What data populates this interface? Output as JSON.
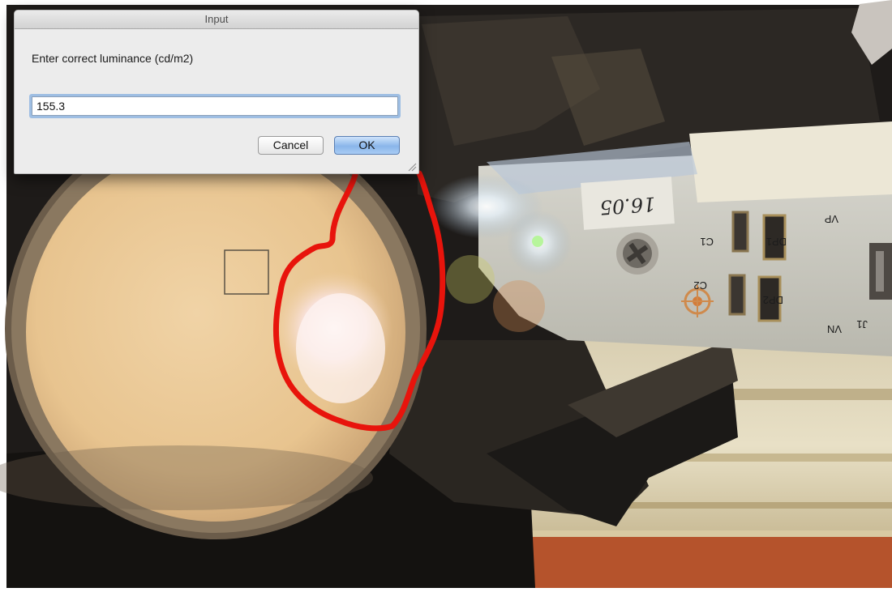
{
  "dialog": {
    "title": "Input",
    "prompt": "Enter correct luminance (cd/m2)",
    "input_value": "155.3",
    "cancel_label": "Cancel",
    "ok_label": "OK"
  },
  "photo": {
    "pcb_labels": {
      "handwritten_date": "16.05",
      "vp": "VP",
      "vn": "VN",
      "j1": "J1",
      "c1": "C1",
      "c2": "C2",
      "dp1": "DP1",
      "dp2": "DP2"
    },
    "annotation_color": "#e8140c"
  }
}
